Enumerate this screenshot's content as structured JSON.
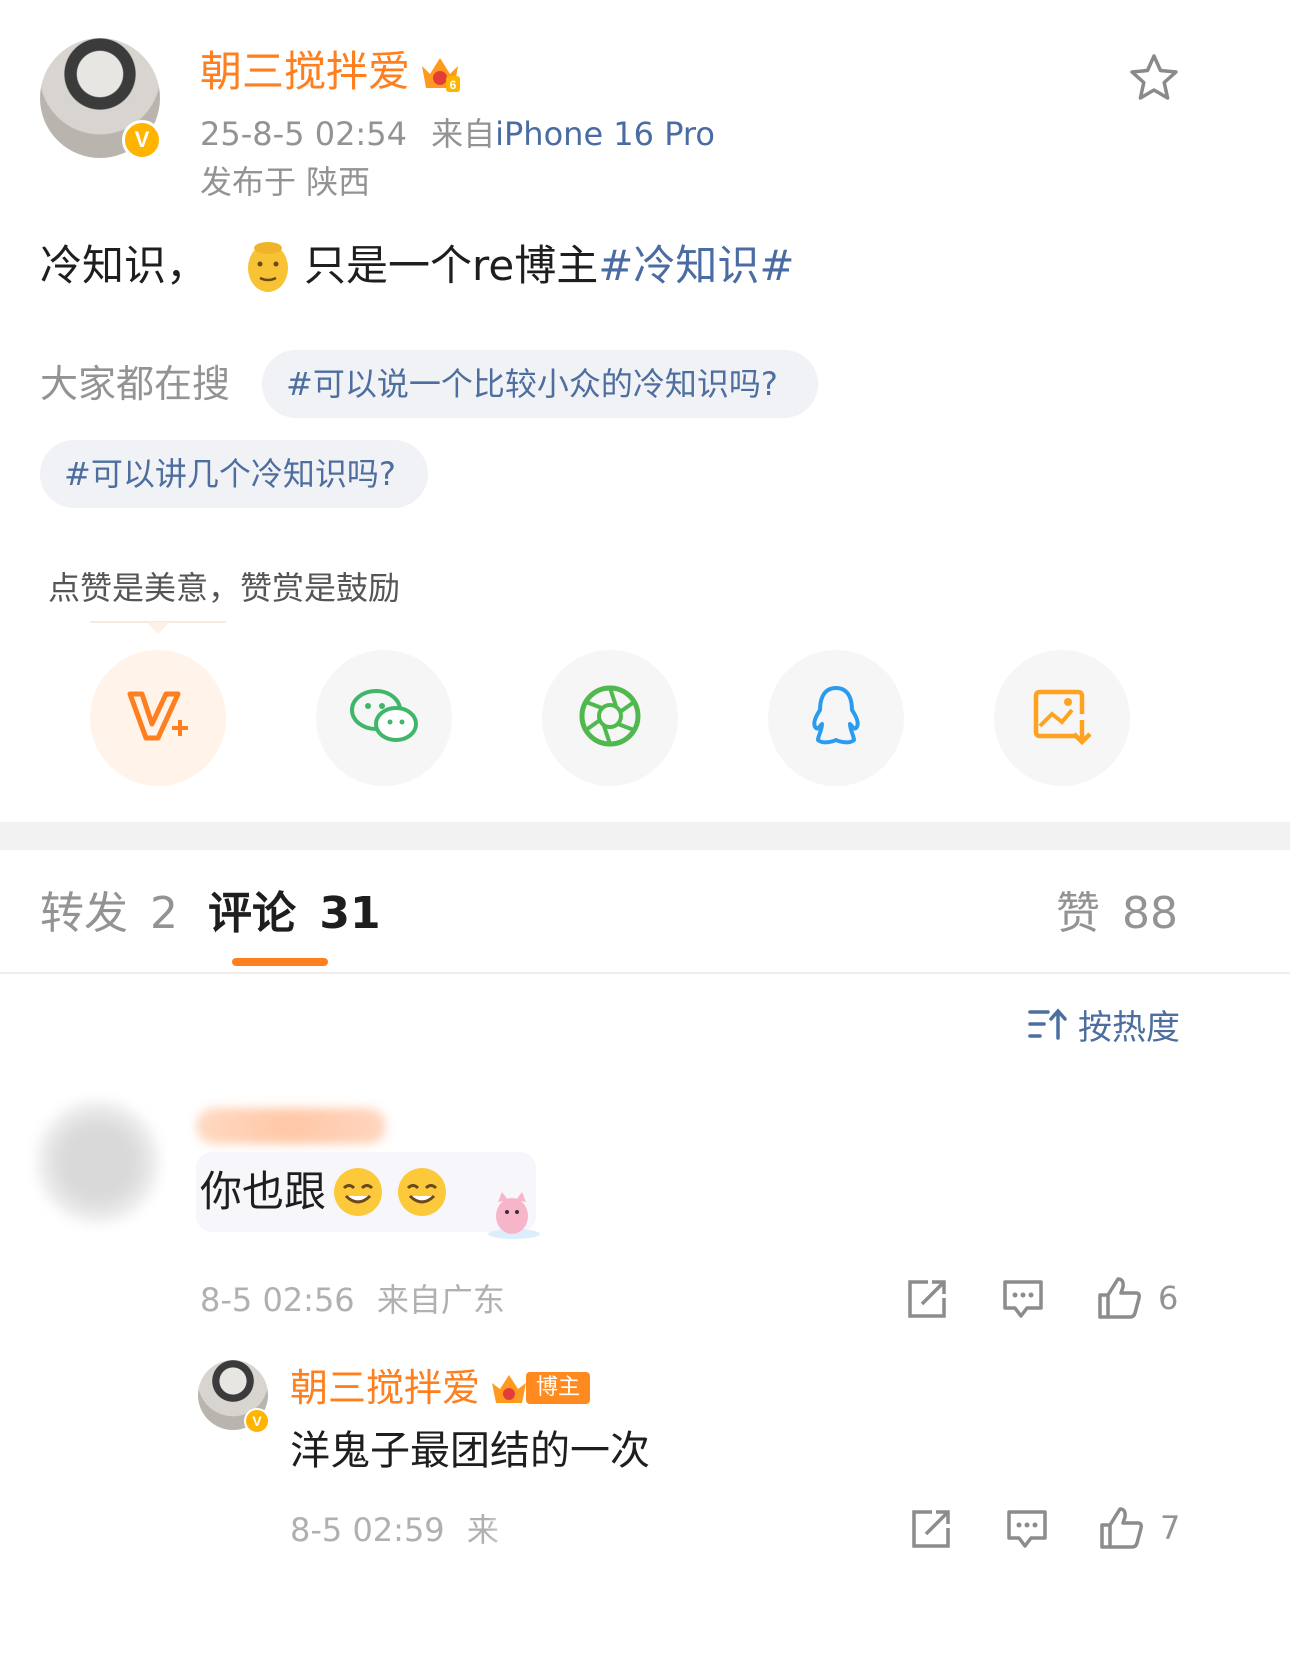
{
  "post": {
    "author": "朝三搅拌爱",
    "date": "25-8-5 02:54",
    "source_prefix": "来自",
    "source_device": "iPhone 16 Pro",
    "location": "发布于 陕西",
    "verified_badge": "V",
    "vip_level": "6",
    "text_before_emoji": "冷知识，",
    "text_after_emoji": "只是一个re博主",
    "hashtag": "#冷知识#"
  },
  "search": {
    "label": "大家都在搜",
    "chips": [
      "#可以说一个比较小众的冷知识吗?",
      "#可以讲几个冷知识吗?"
    ]
  },
  "reward": {
    "tooltip": "点赞是美意，赞赏是鼓励"
  },
  "share_icons": [
    "reward-v-icon",
    "wechat-icon",
    "moments-icon",
    "qq-icon",
    "save-image-icon"
  ],
  "tabs": {
    "repost_label": "转发",
    "repost_count": "2",
    "comment_label": "评论",
    "comment_count": "31",
    "like_label": "赞",
    "like_count": "88"
  },
  "sort": {
    "label": "按热度"
  },
  "comments": [
    {
      "text": "你也跟",
      "date": "8-5 02:56",
      "source": "来自广东",
      "like_count": "6"
    }
  ],
  "reply": {
    "author": "朝三搅拌爱",
    "badge": "博主",
    "vip_level": "6",
    "text": "洋鬼子最团结的一次",
    "date": "8-5 02:59",
    "source_partial": "来",
    "like_count": "7"
  },
  "colors": {
    "accent": "#ff7f1e",
    "link": "#4a6ca3",
    "grey_text": "#939393"
  }
}
